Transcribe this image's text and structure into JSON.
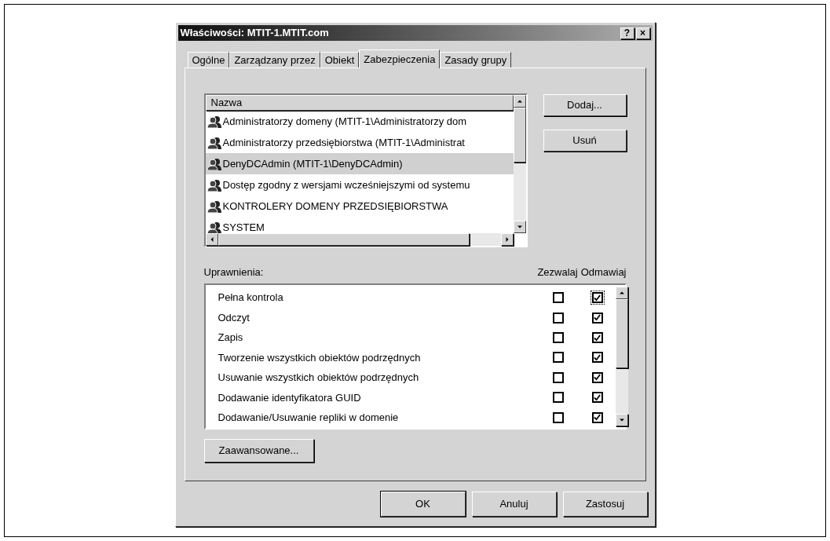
{
  "window": {
    "title": "Właściwości: MTIT-1.MTIT.com",
    "title_buttons": [
      "?",
      "×"
    ]
  },
  "tabs": [
    {
      "label": "Ogólne",
      "selected": false
    },
    {
      "label": "Zarządzany przez",
      "selected": false
    },
    {
      "label": "Obiekt",
      "selected": false
    },
    {
      "label": "Zabezpieczenia",
      "selected": true
    },
    {
      "label": "Zasady grupy",
      "selected": false
    }
  ],
  "names_list": {
    "column": "Nazwa",
    "items": [
      {
        "name": "Administratorzy domeny (MTIT-1\\Administratorzy dom",
        "selected": false
      },
      {
        "name": "Administratorzy przedsiębiorstwa (MTIT-1\\Administrat",
        "selected": false
      },
      {
        "name": "DenyDCAdmin (MTIT-1\\DenyDCAdmin)",
        "selected": true
      },
      {
        "name": "Dostęp zgodny z wersjami wcześniejszymi od systemu",
        "selected": false
      },
      {
        "name": "KONTROLERY DOMENY PRZEDSIĘBIORSTWA",
        "selected": false
      },
      {
        "name": "SYSTEM",
        "selected": false
      }
    ]
  },
  "side_buttons": [
    "Dodaj...",
    "Usuń"
  ],
  "permissions": {
    "label": "Uprawnienia:",
    "columns": [
      "Zezwalaj",
      "Odmawiaj"
    ],
    "rows": [
      {
        "name": "Pełna kontrola",
        "allow": false,
        "deny": true,
        "focused": true
      },
      {
        "name": "Odczyt",
        "allow": false,
        "deny": true,
        "focused": false
      },
      {
        "name": "Zapis",
        "allow": false,
        "deny": true,
        "focused": false
      },
      {
        "name": "Tworzenie wszystkich obiektów podrzędnych",
        "allow": false,
        "deny": true,
        "focused": false
      },
      {
        "name": "Usuwanie wszystkich obiektów podrzędnych",
        "allow": false,
        "deny": true,
        "focused": false
      },
      {
        "name": "Dodawanie identyfikatora GUID",
        "allow": false,
        "deny": true,
        "focused": false
      },
      {
        "name": "Dodawanie/Usuwanie repliki w domenie",
        "allow": false,
        "deny": true,
        "focused": false
      }
    ]
  },
  "advanced_button": "Zaawansowane...",
  "buttons": [
    {
      "label": "OK",
      "default": true
    },
    {
      "label": "Anuluj",
      "default": false
    },
    {
      "label": "Zastosuj",
      "default": false
    }
  ]
}
